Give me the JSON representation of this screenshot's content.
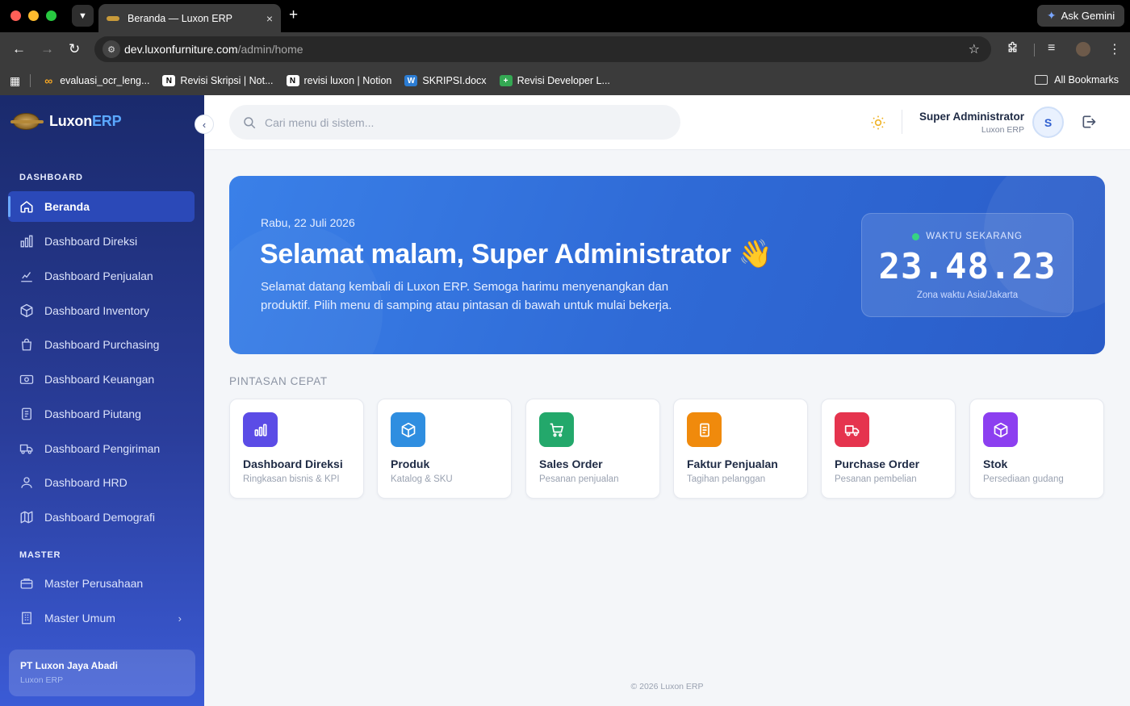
{
  "browser": {
    "tab_title": "Beranda — Luxon ERP",
    "new_tab": "+",
    "close_tab": "×",
    "gemini_label": "Ask Gemini",
    "url_host": "dev.luxonfurniture.com",
    "url_path": "/admin/home",
    "bookmarks": [
      {
        "label": "evaluasi_ocr_leng...",
        "icon": "infinity-icon"
      },
      {
        "label": "Revisi Skripsi | Not...",
        "icon": "notion-icon"
      },
      {
        "label": "revisi luxon | Notion",
        "icon": "notion-icon"
      },
      {
        "label": "SKRIPSI.docx",
        "icon": "word-doc-icon"
      },
      {
        "label": "Revisi Developer L...",
        "icon": "dev-icon"
      }
    ],
    "all_bookmarks": "All Bookmarks"
  },
  "sidebar": {
    "brand_main": "Luxon",
    "brand_accent": "ERP",
    "sections": {
      "dashboard": "DASHBOARD",
      "master": "MASTER"
    },
    "items": [
      {
        "label": "Beranda",
        "icon": "home-icon",
        "active": true
      },
      {
        "label": "Dashboard Direksi",
        "icon": "bar-chart-icon"
      },
      {
        "label": "Dashboard Penjualan",
        "icon": "trend-icon"
      },
      {
        "label": "Dashboard Inventory",
        "icon": "box-icon"
      },
      {
        "label": "Dashboard Purchasing",
        "icon": "shopping-bag-icon"
      },
      {
        "label": "Dashboard Keuangan",
        "icon": "money-icon"
      },
      {
        "label": "Dashboard Piutang",
        "icon": "receipt-icon"
      },
      {
        "label": "Dashboard Pengiriman",
        "icon": "truck-icon"
      },
      {
        "label": "Dashboard HRD",
        "icon": "users-icon"
      },
      {
        "label": "Dashboard Demografi",
        "icon": "map-icon"
      }
    ],
    "master_items": [
      {
        "label": "Master Perusahaan",
        "icon": "briefcase-icon"
      },
      {
        "label": "Master Umum",
        "icon": "building-icon",
        "has_submenu": true
      }
    ],
    "company": {
      "name": "PT Luxon Jaya Abadi",
      "sub": "Luxon ERP"
    }
  },
  "topbar": {
    "search_placeholder": "Cari menu di sistem...",
    "user_name": "Super Administrator",
    "user_sub": "Luxon ERP",
    "avatar_initial": "S"
  },
  "hero": {
    "date": "Rabu, 22 Juli 2026",
    "title": "Selamat malam, Super Administrator 👋",
    "description": "Selamat datang kembali di Luxon ERP. Semoga harimu menyenangkan dan produktif. Pilih menu di samping atau pintasan di bawah untuk mulai bekerja.",
    "clock_label": "WAKTU SEKARANG",
    "clock_time": "23.48.23",
    "clock_tz": "Zona waktu Asia/Jakarta"
  },
  "quick": {
    "label": "PINTASAN CEPAT",
    "cards": [
      {
        "title": "Dashboard Direksi",
        "sub": "Ringkasan bisnis & KPI",
        "icon": "bar-chart-icon",
        "color": "#5b4ce6"
      },
      {
        "title": "Produk",
        "sub": "Katalog & SKU",
        "icon": "box-icon",
        "color": "#2f8ee0"
      },
      {
        "title": "Sales Order",
        "sub": "Pesanan penjualan",
        "icon": "cart-icon",
        "color": "#23a86b"
      },
      {
        "title": "Faktur Penjualan",
        "sub": "Tagihan pelanggan",
        "icon": "receipt-icon",
        "color": "#f08a0c"
      },
      {
        "title": "Purchase Order",
        "sub": "Pesanan pembelian",
        "icon": "truck-icon",
        "color": "#e5344e"
      },
      {
        "title": "Stok",
        "sub": "Persediaan gudang",
        "icon": "box-icon",
        "color": "#8c3ff0"
      }
    ]
  },
  "footer": "© 2026 Luxon ERP"
}
